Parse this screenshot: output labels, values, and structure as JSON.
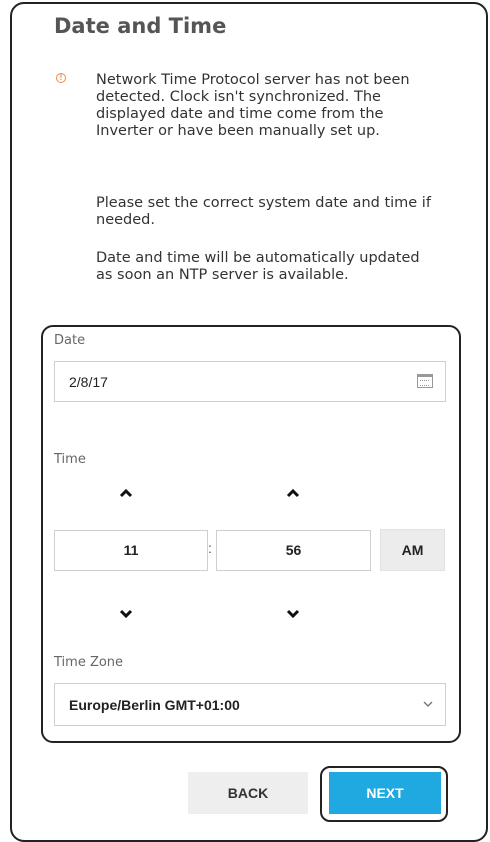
{
  "title": "Date and Time",
  "notice": {
    "icon": "warning-circle-icon",
    "icon_color": "#f08a4b",
    "paragraph1": "Network Time Protocol server has not been detected. Clock isn't synchronized. The displayed date and time come from the Inverter or have been manually set up.",
    "paragraph2": "Please set the correct system date and time if needed.",
    "paragraph3": "Date and time will be automatically updated as soon an NTP server is available."
  },
  "date": {
    "label": "Date",
    "value": "2/8/17",
    "icon": "calendar-icon"
  },
  "time": {
    "label": "Time",
    "hours": "11",
    "separator": ":",
    "minutes": "56",
    "ampm": "AM",
    "up_icon": "chevron-up-icon",
    "down_icon": "chevron-down-icon"
  },
  "timezone": {
    "label": "Time Zone",
    "value": "Europe/Berlin GMT+01:00",
    "icon": "chevron-down-icon"
  },
  "buttons": {
    "back": "BACK",
    "next": "NEXT"
  },
  "colors": {
    "accent": "#20a8e0",
    "warning": "#f08a4b"
  }
}
